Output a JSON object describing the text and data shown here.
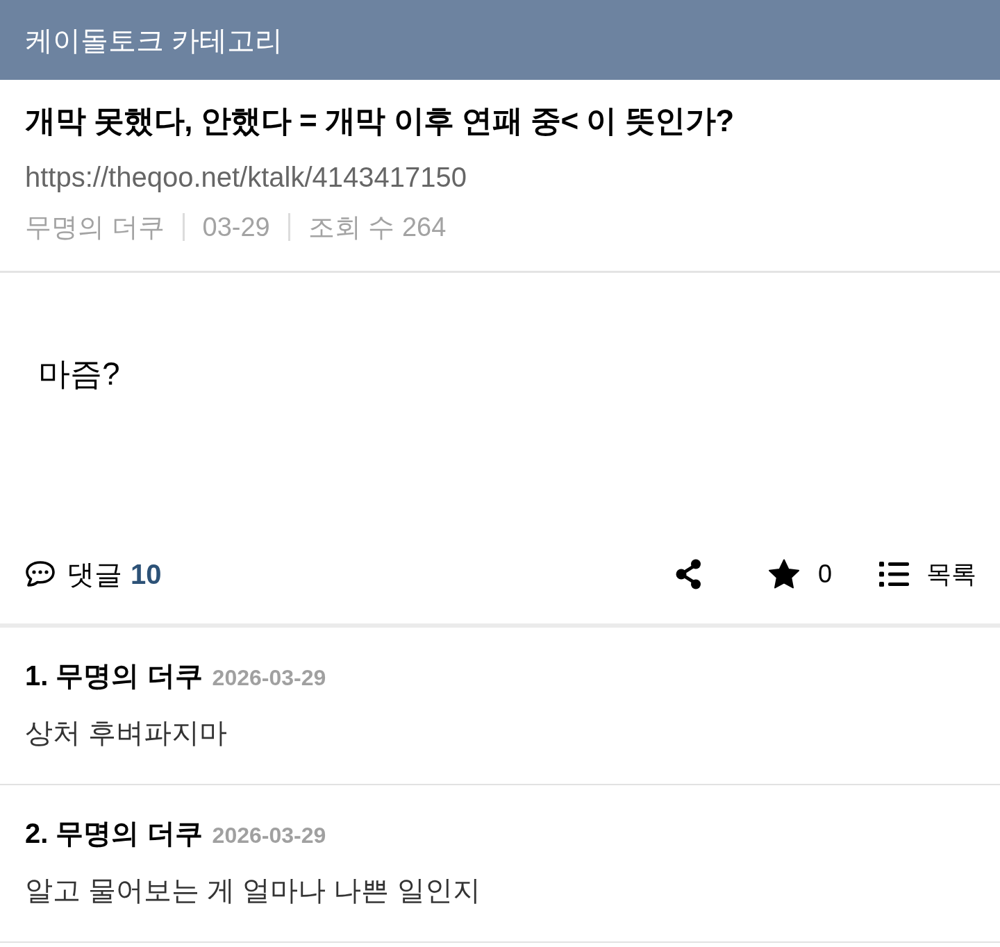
{
  "header": {
    "title": "케이돌토크 카테고리"
  },
  "post": {
    "title": "개막 못했다, 안했다 = 개막 이후 연패 중< 이 뜻인가?",
    "url": "https://theqoo.net/ktalk/4143417150",
    "meta": [
      "무명의 더쿠",
      "03-29",
      "조회 수 264"
    ],
    "body": "마즘?"
  },
  "actions": {
    "comments_label": "댓글",
    "comments_count": "10",
    "favorite_count": "0",
    "list_label": "목록"
  },
  "comments": [
    {
      "heading": "1. 무명의 더쿠",
      "date": "2026-03-29",
      "text": "상처 후벼파지마"
    },
    {
      "heading": "2. 무명의 더쿠",
      "date": "2026-03-29",
      "text": "알고 물어보는 게 얼마나 나쁜 일인지"
    }
  ]
}
